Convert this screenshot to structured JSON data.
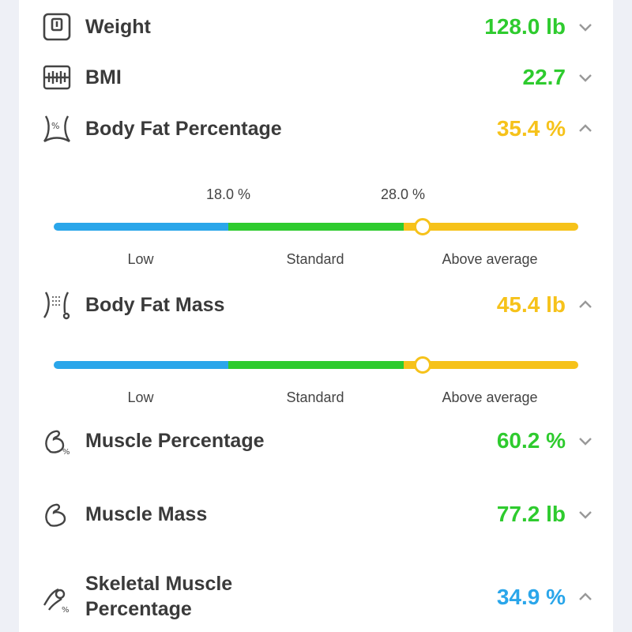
{
  "metrics": {
    "weight": {
      "label": "Weight",
      "value": "128.0 lb",
      "color": "#2ecb2e",
      "icon": "scale-icon",
      "expanded": false
    },
    "bmi": {
      "label": "BMI",
      "value": "22.7",
      "color": "#2ecb2e",
      "icon": "bmi-icon",
      "expanded": false
    },
    "body_fat_pct": {
      "label": "Body Fat Percentage",
      "value": "35.4 %",
      "color": "#f6c21a",
      "icon": "body-fat-percentage-icon",
      "expanded": true,
      "thresholds": [
        "18.0 %",
        "28.0 %"
      ],
      "categories": [
        "Low",
        "Standard",
        "Above average"
      ],
      "marker_fraction": 0.703
    },
    "body_fat_mass": {
      "label": "Body Fat Mass",
      "value": "45.4 lb",
      "color": "#f6c21a",
      "icon": "body-fat-mass-icon",
      "expanded": true,
      "categories": [
        "Low",
        "Standard",
        "Above average"
      ],
      "marker_fraction": 0.703
    },
    "muscle_pct": {
      "label": "Muscle Percentage",
      "value": "60.2 %",
      "color": "#2ecb2e",
      "icon": "muscle-percentage-icon",
      "expanded": false
    },
    "muscle_mass": {
      "label": "Muscle Mass",
      "value": "77.2 lb",
      "color": "#2ecb2e",
      "icon": "muscle-mass-icon",
      "expanded": false
    },
    "skeletal_muscle_pct": {
      "label_line1": "Skeletal Muscle",
      "label_line2": "Percentage",
      "value": "34.9 %",
      "color": "#2aa6ea",
      "icon": "skeletal-muscle-icon",
      "expanded": true
    }
  },
  "colors": {
    "low": "#2aa6ea",
    "standard": "#2ecb2e",
    "above_average": "#f6c21a"
  }
}
